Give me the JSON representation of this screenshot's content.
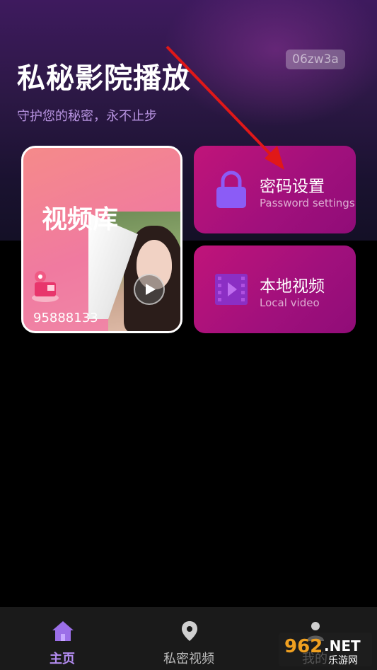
{
  "header": {
    "title": "私秘影院播放",
    "subtitle": "守护您的秘密，永不止步",
    "badge": "06zw3a"
  },
  "library": {
    "title": "视频库",
    "count": "95888133"
  },
  "menu": [
    {
      "title": "密码设置",
      "subtitle": "Password settings",
      "icon": "lock-icon"
    },
    {
      "title": "本地视频",
      "subtitle": "Local video",
      "icon": "film-icon"
    }
  ],
  "nav": [
    {
      "label": "主页",
      "icon": "home-icon",
      "active": true
    },
    {
      "label": "私密视频",
      "icon": "location-pin-icon",
      "active": false
    },
    {
      "label": "我的",
      "icon": "user-icon",
      "active": false
    }
  ],
  "logo": {
    "text_top": "962",
    "text_suffix": ".NET",
    "text_bottom": "乐游网"
  },
  "colors": {
    "accent": "#b38cf0",
    "card": "#a0107c",
    "arrow": "#e01818"
  }
}
